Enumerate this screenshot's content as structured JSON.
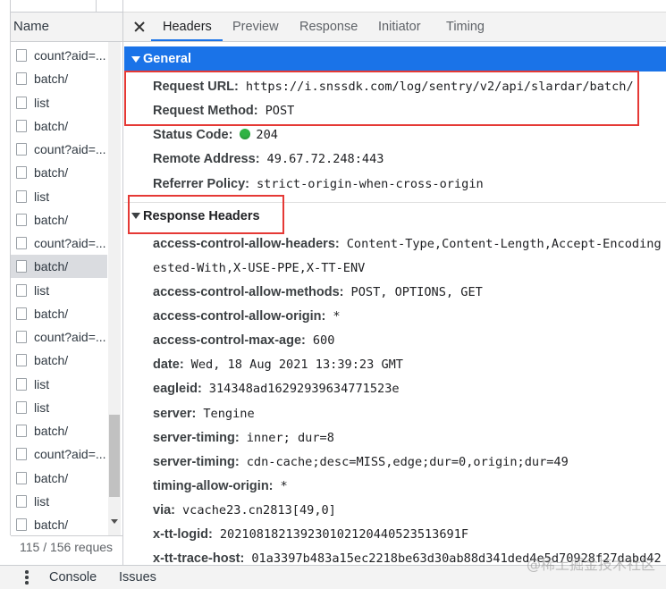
{
  "left": {
    "header_label": "Name",
    "file_icon": "file-icon",
    "requests": [
      {
        "label": "count?aid=..."
      },
      {
        "label": "batch/"
      },
      {
        "label": "list"
      },
      {
        "label": "batch/"
      },
      {
        "label": "count?aid=..."
      },
      {
        "label": "batch/"
      },
      {
        "label": "list"
      },
      {
        "label": "batch/"
      },
      {
        "label": "count?aid=..."
      },
      {
        "label": "batch/",
        "selected": true
      },
      {
        "label": "list"
      },
      {
        "label": "batch/"
      },
      {
        "label": "count?aid=..."
      },
      {
        "label": "batch/"
      },
      {
        "label": "list"
      },
      {
        "label": "list"
      },
      {
        "label": "batch/"
      },
      {
        "label": "count?aid=..."
      },
      {
        "label": "batch/"
      },
      {
        "label": "list"
      },
      {
        "label": "batch/"
      }
    ],
    "status": "115 / 156 reques",
    "scroll_down_icon": "scroll-down-arrow-icon"
  },
  "tabs": {
    "close_icon": "close-icon",
    "items": [
      "Headers",
      "Preview",
      "Response",
      "Initiator",
      "Timing"
    ],
    "active_index": 0
  },
  "general": {
    "toggle_icon": "triangle-down-icon",
    "title": "General",
    "rows": [
      {
        "label": "Request URL:",
        "value": "https://i.snssdk.com/log/sentry/v2/api/slardar/batch/"
      },
      {
        "label": "Request Method:",
        "value": "POST"
      },
      {
        "label": "Status Code:",
        "value": "204",
        "indicator": "status-ok-dot-icon"
      },
      {
        "label": "Remote Address:",
        "value": "49.67.72.248:443"
      },
      {
        "label": "Referrer Policy:",
        "value": "strict-origin-when-cross-origin"
      }
    ]
  },
  "response_headers": {
    "toggle_icon": "triangle-down-icon",
    "title": "Response Headers",
    "rows": [
      {
        "name": "access-control-allow-headers:",
        "value": "Content-Type,Content-Length,Accept-Encoding",
        "value_wrap": "ested-With,X-USE-PPE,X-TT-ENV"
      },
      {
        "name": "access-control-allow-methods:",
        "value": "POST, OPTIONS, GET"
      },
      {
        "name": "access-control-allow-origin:",
        "value": "*"
      },
      {
        "name": "access-control-max-age:",
        "value": "600"
      },
      {
        "name": "date:",
        "value": "Wed, 18 Aug 2021 13:39:23 GMT"
      },
      {
        "name": "eagleid:",
        "value": "314348ad16292939634771523e"
      },
      {
        "name": "server:",
        "value": "Tengine"
      },
      {
        "name": "server-timing:",
        "value": "inner; dur=8"
      },
      {
        "name": "server-timing:",
        "value": "cdn-cache;desc=MISS,edge;dur=0,origin;dur=49"
      },
      {
        "name": "timing-allow-origin:",
        "value": "*"
      },
      {
        "name": "via:",
        "value": "vcache23.cn2813[49,0]"
      },
      {
        "name": "x-tt-logid:",
        "value": "202108182139230102120440523513691F"
      },
      {
        "name": "x-tt-trace-host:",
        "value": "01a3397b483a15ec2218be63d30ab88d341ded4e5d70928f27dabd42"
      }
    ]
  },
  "drawer": {
    "menu_icon": "more-vert-icon",
    "tabs": [
      "Console",
      "Issues"
    ]
  },
  "watermark": "@稀土掘金技术社区",
  "colors": {
    "accent": "#1a73e8",
    "highlight_box": "#e53935",
    "status_ok": "#2fb344",
    "selected_row": "#dadce0"
  }
}
